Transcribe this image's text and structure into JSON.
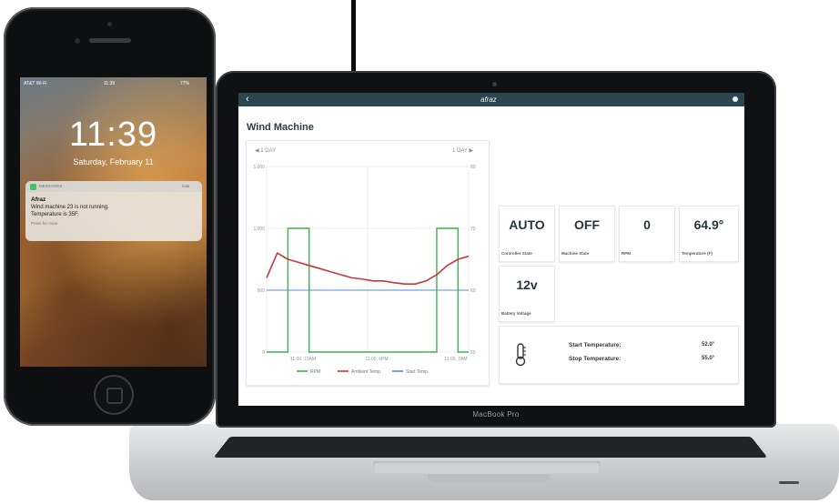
{
  "phone": {
    "status_bar": {
      "carrier": "AT&T Wi-Fi",
      "time": "11:39",
      "battery": "77%"
    },
    "lock_time": "11:39",
    "lock_date": "Saturday, February 11",
    "notification": {
      "app_name": "MESSAGES",
      "time": "now",
      "title": "Afraz",
      "body_line1": "Wind machine 23 is not running.",
      "body_line2": "Temperature is 35F.",
      "more": "Press for more"
    }
  },
  "laptop": {
    "brand": "MacBook Pro",
    "app": {
      "logo": "afraz",
      "page_title": "Wind Machine",
      "chart": {
        "prev_label": "◀ 1 DAY",
        "next_label": "1 DAY ▶",
        "y_left_ticks": [
          "1,000",
          "1,000",
          "500",
          "0"
        ],
        "y_right_ticks": [
          "80",
          "70",
          "60",
          "50"
        ],
        "x_ticks": [
          "11:00, 10AM",
          "11:00, 6PM",
          "11:00, 7AM"
        ],
        "legend": [
          "RPM",
          "Ambient Temp",
          "Start Temp"
        ],
        "colors": {
          "rpm": "#3cb34a",
          "ambient": "#c8363a",
          "start": "#4f8fd1"
        },
        "chart_data": {
          "type": "line",
          "x": [
            "11:00, 10AM",
            "11:00, 6PM",
            "11:00, 7AM"
          ],
          "series": [
            {
              "name": "RPM",
              "axis": "left",
              "values": [
                0,
                0,
                1000,
                1000,
                0,
                0,
                0,
                0,
                0,
                0,
                0,
                0,
                0,
                0,
                0,
                0,
                1000,
                1000,
                0,
                0
              ]
            },
            {
              "name": "Ambient Temp",
              "axis": "right",
              "values": [
                62,
                66,
                65,
                64.5,
                64,
                63.5,
                63,
                62.5,
                62,
                61.8,
                61.5,
                61.5,
                61.2,
                61,
                61,
                61.5,
                62.5,
                64,
                65,
                65.5
              ]
            },
            {
              "name": "Start Temp",
              "axis": "right",
              "values": [
                60,
                60,
                60,
                60,
                60,
                60,
                60,
                60,
                60,
                60,
                60,
                60,
                60,
                60,
                60,
                60,
                60,
                60,
                60,
                60
              ]
            }
          ]
        }
      },
      "tiles": [
        {
          "value": "AUTO",
          "label": "Controller State"
        },
        {
          "value": "OFF",
          "label": "Machine State"
        },
        {
          "value": "0",
          "label": "RPM"
        },
        {
          "value": "64.9°",
          "label": "Temperature (F)"
        },
        {
          "value": "12v",
          "label": "Battery Voltage"
        }
      ],
      "temps": {
        "start_label": "Start Temperature:",
        "start_value": "52.0°",
        "stop_label": "Stop Temperature:",
        "stop_value": "55.0°"
      }
    }
  }
}
